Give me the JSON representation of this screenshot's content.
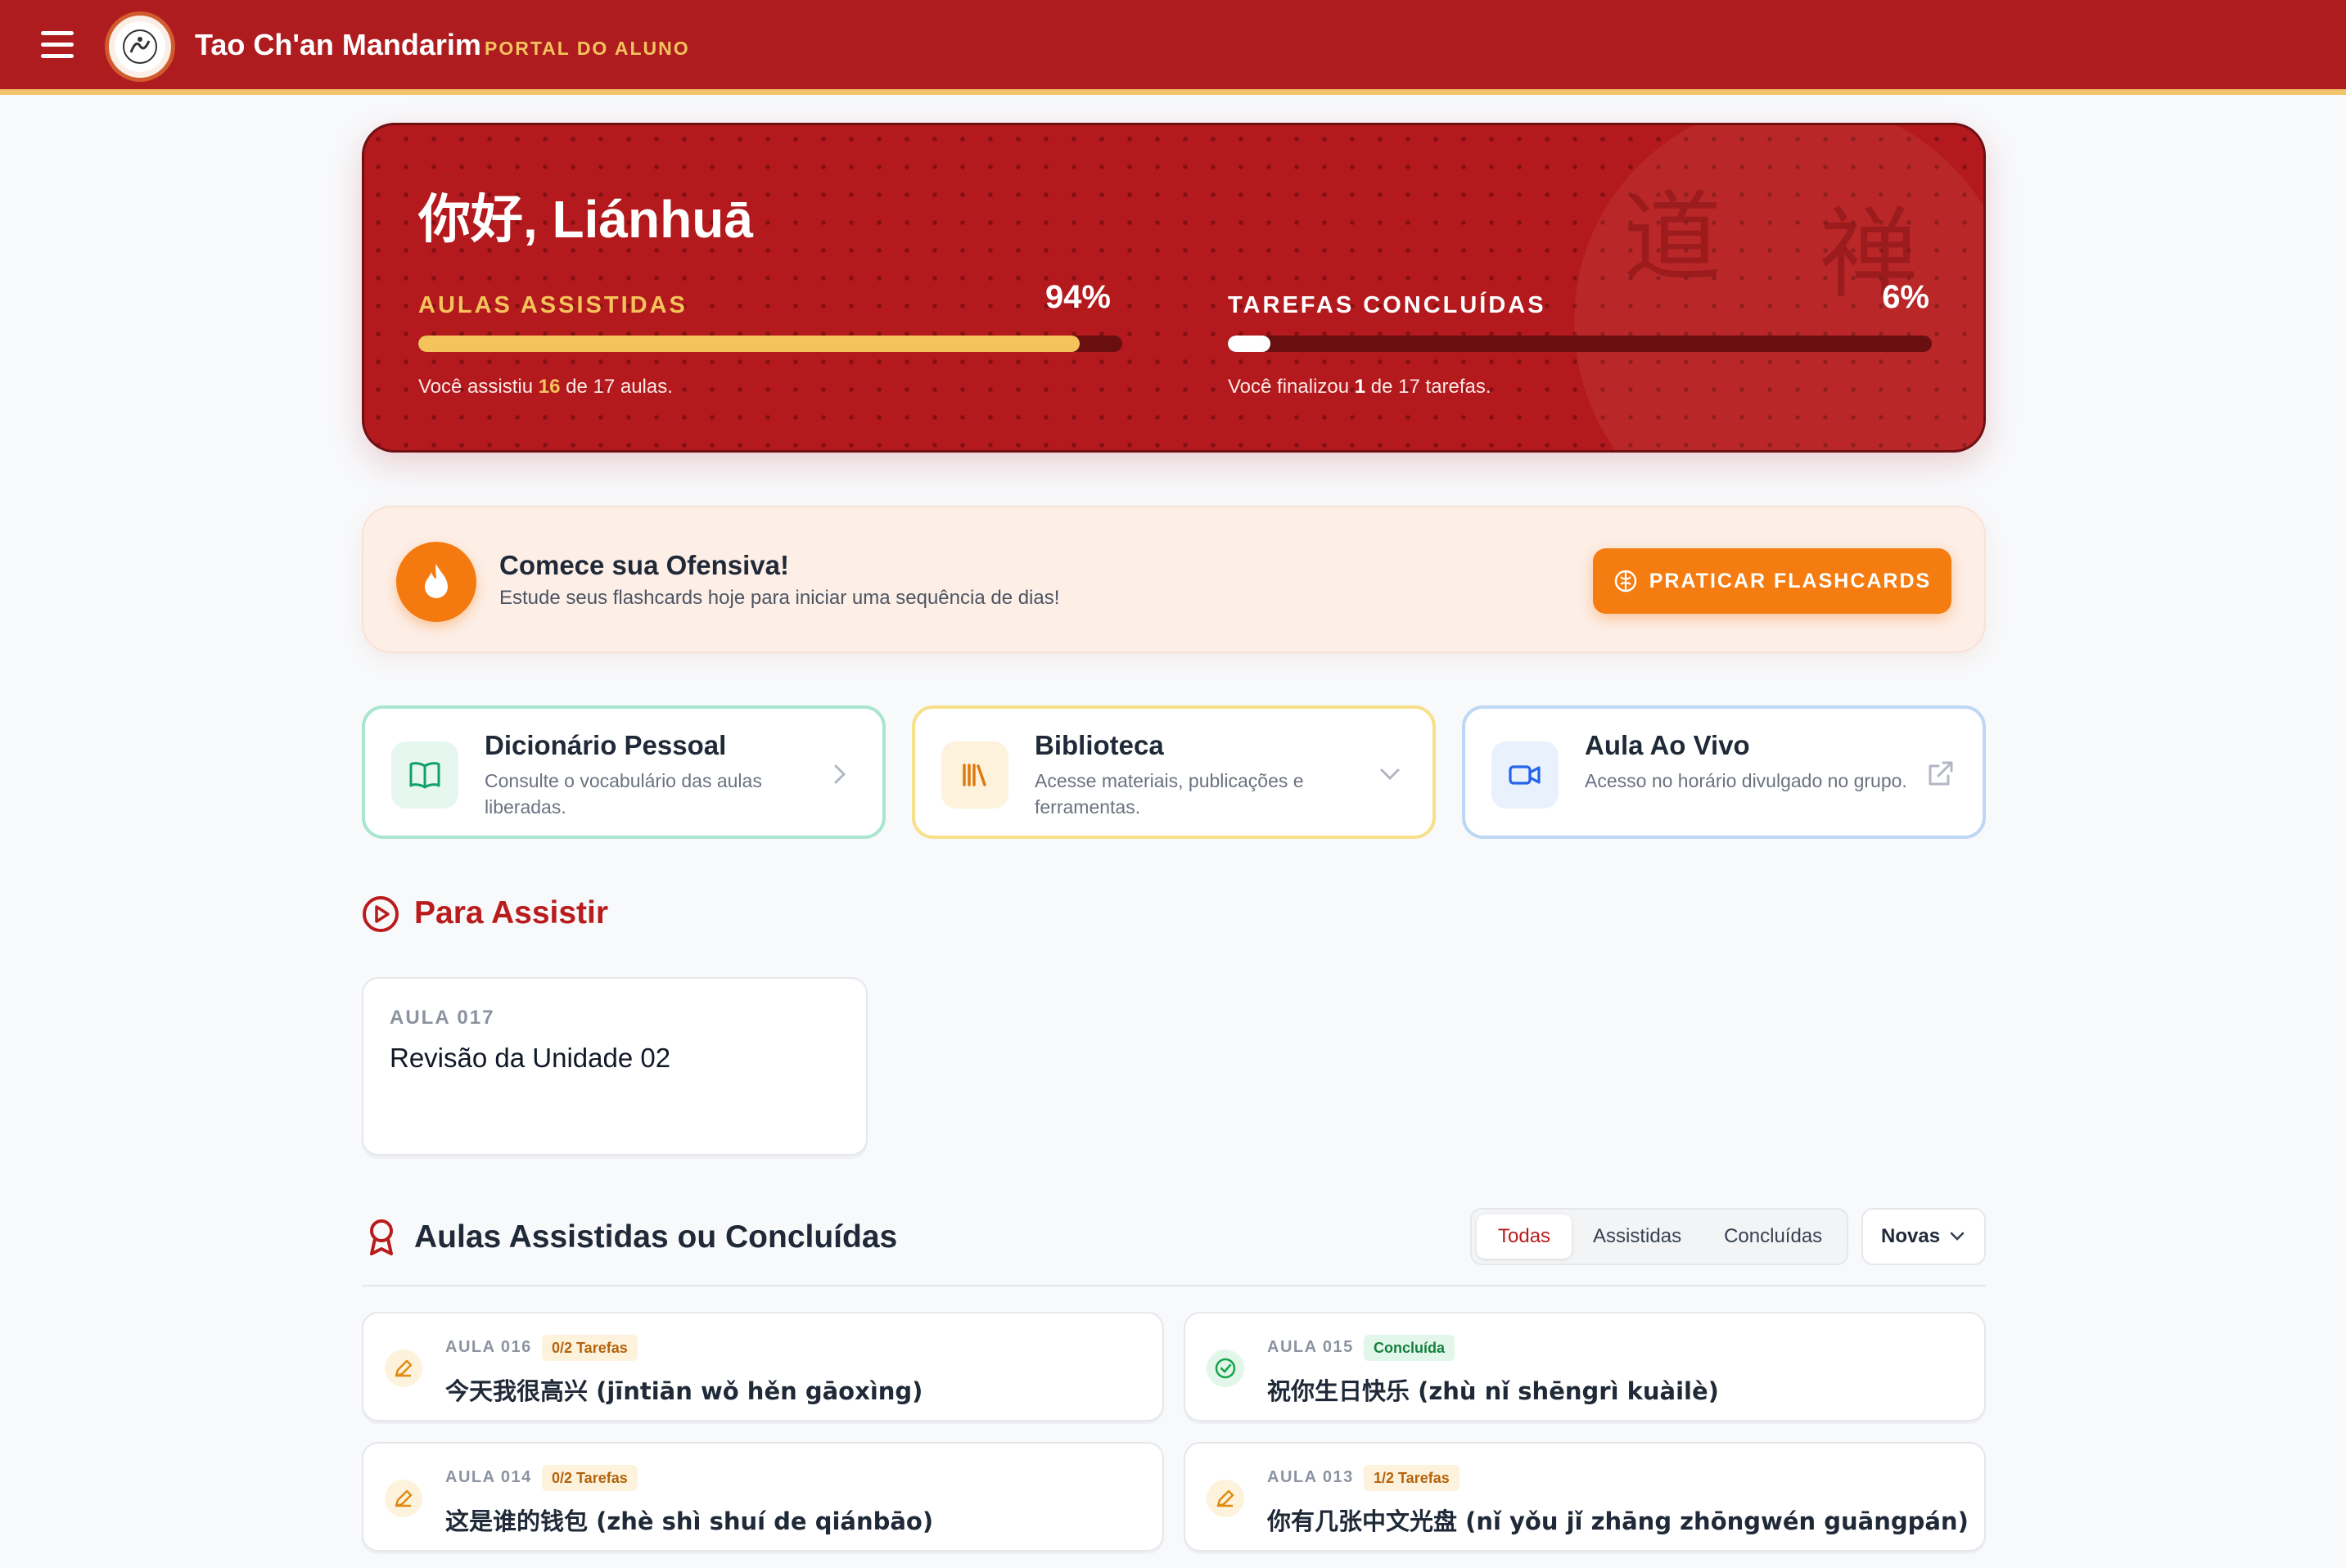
{
  "header": {
    "title": "Tao Ch'an Mandarim",
    "subtitle": "PORTAL DO ALUNO"
  },
  "hero": {
    "greeting": "你好, Liánhuā",
    "watched": {
      "label": "AULAS ASSISTIDAS",
      "percent_text": "94%",
      "progress": 0.94,
      "note_prefix": "Você assistiu ",
      "note_count": "16",
      "note_suffix": " de 17 aulas."
    },
    "tasks": {
      "label": "TAREFAS CONCLUÍDAS",
      "percent_text": "6%",
      "progress": 0.06,
      "note_prefix": "Você finalizou ",
      "note_count": "1",
      "note_suffix": " de 17 tarefas."
    },
    "seal_glyphs": [
      "道",
      "禅"
    ]
  },
  "streak": {
    "title": "Comece sua Ofensiva!",
    "subtitle": "Estude seus flashcards hoje para iniciar uma sequência de dias!",
    "button_label": "PRATICAR FLASHCARDS"
  },
  "quick_links": [
    {
      "title": "Dicionário Pessoal",
      "description": "Consulte o vocabulário das aulas liberadas.",
      "icon": "book-open-icon",
      "action_icon": "chevron-right-icon"
    },
    {
      "title": "Biblioteca",
      "description": "Acesse materiais, publicações e ferramentas.",
      "icon": "library-icon",
      "action_icon": "chevron-down-icon"
    },
    {
      "title": "Aula Ao Vivo",
      "description": "Acesso no horário divulgado no grupo.",
      "icon": "video-camera-icon",
      "action_icon": "external-link-icon"
    }
  ],
  "to_watch": {
    "title": "Para Assistir",
    "items": [
      {
        "kicker": "AULA 017",
        "name": "Revisão da Unidade 02"
      }
    ]
  },
  "watched_section": {
    "title": "Aulas Assistidas ou Concluídas",
    "filters": [
      "Todas",
      "Assistidas",
      "Concluídas"
    ],
    "active_filter": "Todas",
    "sort": "Novas",
    "lessons": [
      {
        "kicker": "AULA 016",
        "badge": "0/2 Tarefas",
        "badge_type": "task",
        "name": "今天我很高兴 (jīntiān wǒ hěn gāoxìng)",
        "icon": "pencil-icon"
      },
      {
        "kicker": "AULA 015",
        "badge": "Concluída",
        "badge_type": "done",
        "name": "祝你生日快乐 (zhù nǐ shēngrì kuàilè)",
        "icon": "check-circle-icon"
      },
      {
        "kicker": "AULA 014",
        "badge": "0/2 Tarefas",
        "badge_type": "task",
        "name": "这是谁的钱包 (zhè shì shuí de qiánbāo)",
        "icon": "pencil-icon"
      },
      {
        "kicker": "AULA 013",
        "badge": "1/2 Tarefas",
        "badge_type": "task",
        "name": "你有几张中文光盘 (nǐ yǒu jǐ zhāng zhōngwén guāngpán)",
        "icon": "pencil-icon"
      }
    ]
  },
  "colors": {
    "brand_red": "#ae1c1f",
    "gold": "#f5c35e",
    "orange": "#f57c10",
    "green": "#15803d"
  }
}
